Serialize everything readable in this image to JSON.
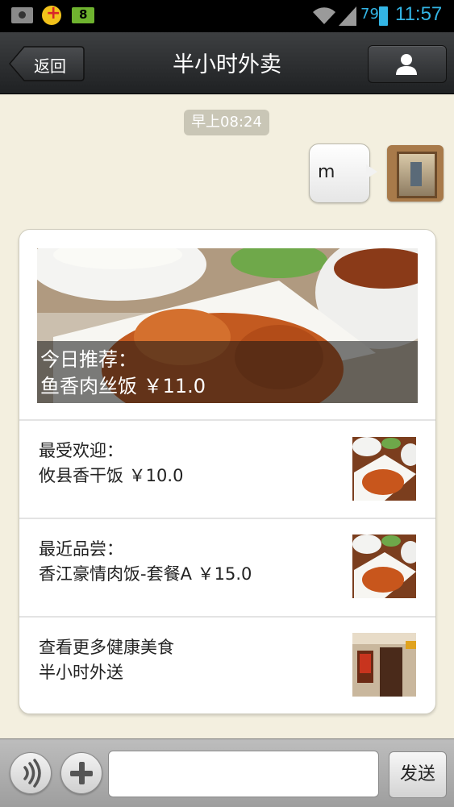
{
  "status_bar": {
    "notif_icons": [
      "photo-icon",
      "game-icon",
      "battery-app-icon"
    ],
    "battery_app_digit": "8",
    "battery_percent": "79",
    "time": "11:57",
    "accent_color": "#33b5e5"
  },
  "title_bar": {
    "back_label": "返回",
    "title": "半小时外卖",
    "profile_icon": "person-icon"
  },
  "chat": {
    "timestamp": "早上08:24",
    "messages": [
      {
        "from": "me",
        "text": "m"
      }
    ]
  },
  "card": {
    "hero": {
      "line1": "今日推荐：",
      "line2": "鱼香肉丝饭 ￥11.0"
    },
    "items": [
      {
        "line1": "最受欢迎：",
        "line2": "攸县香干饭 ￥10.0",
        "thumb": "food-dish-thumbnail"
      },
      {
        "line1": "最近品尝：",
        "line2": "香江豪情肉饭-套餐A ￥15.0",
        "thumb": "food-dish-thumbnail"
      },
      {
        "line1": "查看更多健康美食",
        "line2": "半小时外送",
        "thumb": "restaurant-storefront-thumbnail"
      }
    ]
  },
  "input_bar": {
    "voice_icon": "voice-icon",
    "plus_icon": "plus-icon",
    "input_value": "",
    "send_label": "发送"
  }
}
